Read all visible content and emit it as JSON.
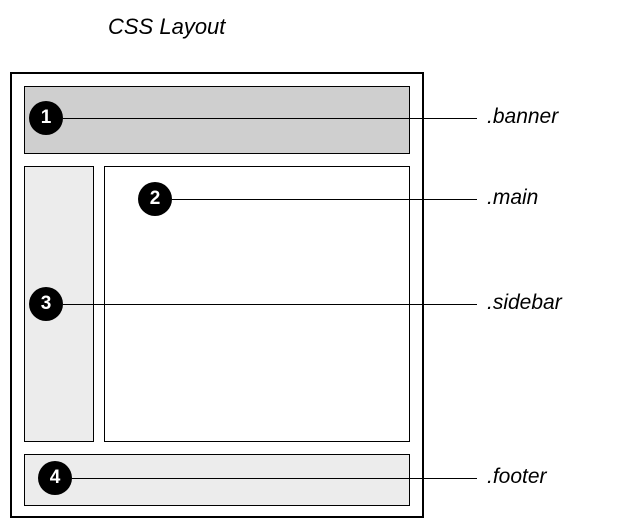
{
  "title": "CSS Layout",
  "markers": {
    "m1": "1",
    "m2": "2",
    "m3": "3",
    "m4": "4"
  },
  "labels": {
    "banner": ".banner",
    "main": ".main",
    "sidebar": ".sidebar",
    "footer": ".footer"
  }
}
